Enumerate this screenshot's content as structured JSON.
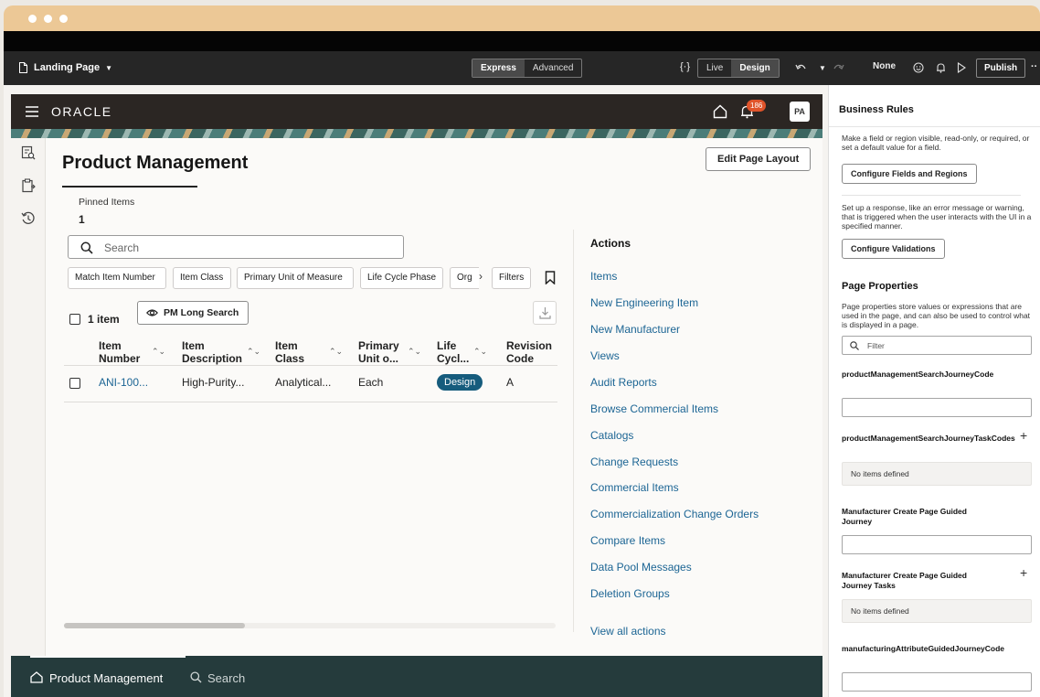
{
  "builder": {
    "page_name": "Landing Page",
    "modes": [
      "Express",
      "Advanced"
    ],
    "active_mode": "Express",
    "code_icon_label": "{•}",
    "views": [
      "Live",
      "Design"
    ],
    "active_view": "Design",
    "redo_target": "None",
    "publish_label": "Publish"
  },
  "app": {
    "brand": "ORACLE",
    "notification_count": "186",
    "avatar_initials": "PA"
  },
  "page": {
    "title": "Product Management",
    "edit_layout_label": "Edit Page Layout",
    "pinned_label": "Pinned Items",
    "pinned_count": "1",
    "search_placeholder": "Search",
    "filter_chips": [
      "Match Item Number",
      "Item Class",
      "Primary Unit of Measure",
      "Life Cycle Phase",
      "Org"
    ],
    "filters_label": "Filters",
    "item_count": "1 item",
    "saved_search_label": "PM Long Search",
    "columns": [
      {
        "line1": "Item",
        "line2": "Number"
      },
      {
        "line1": "Item",
        "line2": "Description"
      },
      {
        "line1": "Item",
        "line2": "Class"
      },
      {
        "line1": "Primary",
        "line2": "Unit o..."
      },
      {
        "line1": "Life",
        "line2": "Cycl..."
      },
      {
        "line1": "Revision",
        "line2": "Code"
      }
    ],
    "rows": [
      {
        "item_number": "ANI-100...",
        "description": "High-Purity...",
        "item_class": "Analytical...",
        "unit": "Each",
        "life_cycle": "Design",
        "revision": "A"
      }
    ],
    "actions_title": "Actions",
    "actions": [
      "Items",
      "New Engineering Item",
      "New Manufacturer",
      "Views",
      "Audit Reports",
      "Browse Commercial Items",
      "Catalogs",
      "Change Requests",
      "Commercial Items",
      "Commercialization Change Orders",
      "Compare Items",
      "Data Pool Messages",
      "Deletion Groups"
    ],
    "view_all_actions": "View all actions"
  },
  "bottom_nav": {
    "product_management": "Product Management",
    "search": "Search"
  },
  "panel": {
    "business_rules_title": "Business Rules",
    "rules_desc": "Make a field or region visible, read-only, or required, or set a default value for a field.",
    "configure_fields_label": "Configure Fields and Regions",
    "validations_desc": "Set up a response, like an error message or warning, that is triggered when the user interacts with the UI in a specified manner.",
    "configure_validations_label": "Configure Validations",
    "page_properties_title": "Page Properties",
    "page_properties_desc": "Page properties store values or expressions that are used in the page, and can also be used to control what is displayed in a page.",
    "filter_placeholder": "Filter",
    "properties": [
      {
        "label": "productManagementSearchJourneyCode",
        "kind": "input"
      },
      {
        "label": "productManagementSearchJourneyTaskCodes",
        "kind": "list",
        "empty": "No items defined"
      },
      {
        "label": "Manufacturer Create Page Guided Journey",
        "kind": "input"
      },
      {
        "label": "Manufacturer Create Page Guided Journey Tasks",
        "kind": "list",
        "empty": "No items defined"
      },
      {
        "label": "manufacturingAttributeGuidedJourneyCode",
        "kind": "input"
      }
    ]
  },
  "colors": {
    "accent_teal": "#253b3c",
    "link": "#1c6594",
    "badge": "#165c7d",
    "notification": "#e0542b",
    "chrome": "#ecc896"
  }
}
